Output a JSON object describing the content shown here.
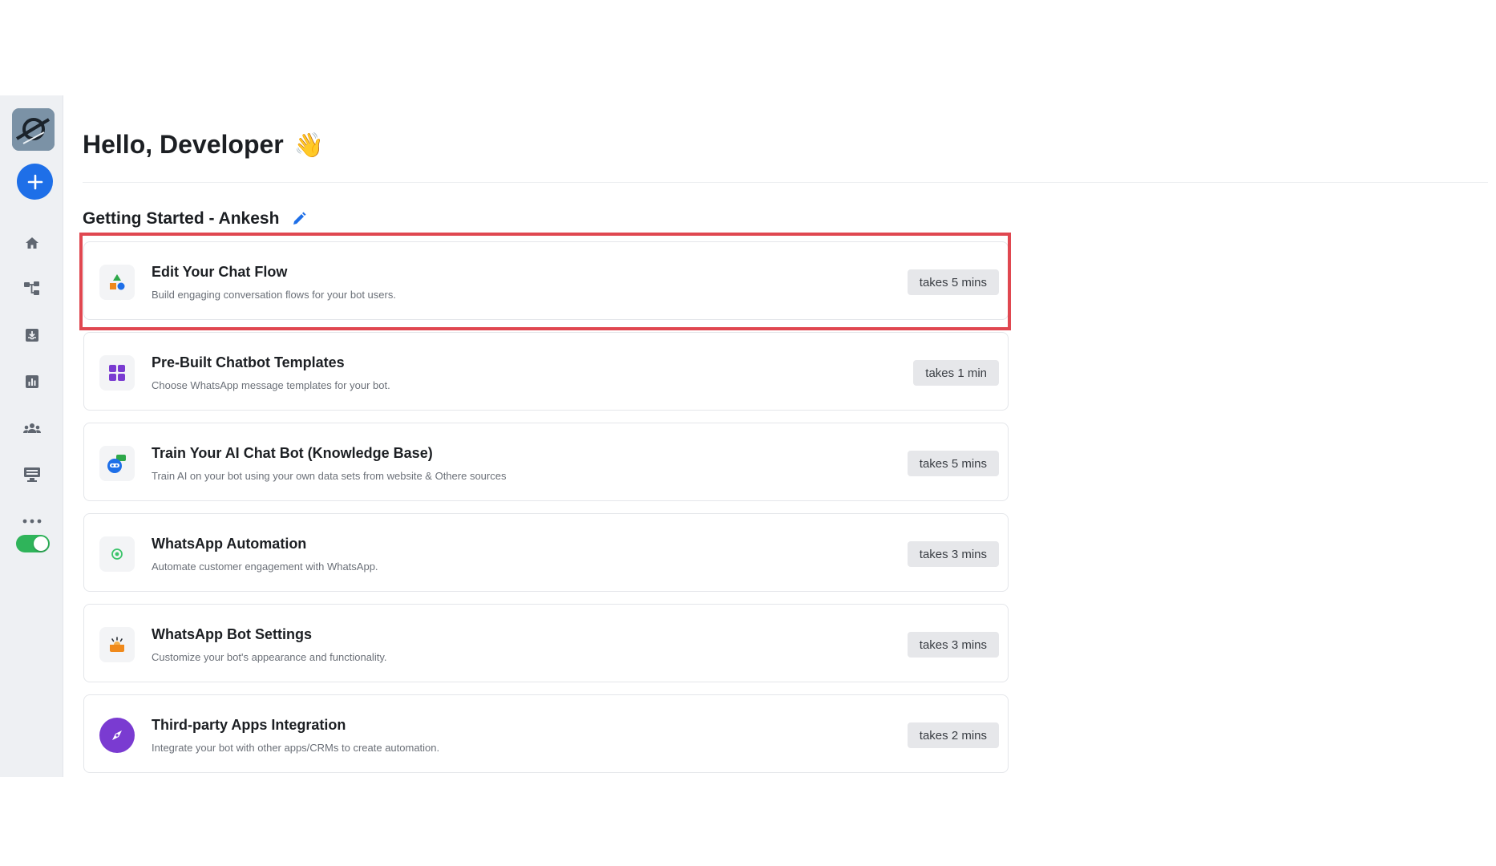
{
  "header": {
    "greeting": "Hello, Developer",
    "greeting_emoji": "👋"
  },
  "section": {
    "title": "Getting Started - Ankesh"
  },
  "cards": [
    {
      "title": "Edit Your Chat Flow",
      "description": "Build engaging conversation flows for your bot users.",
      "duration": "takes 5 mins",
      "icon": "shapes-icon"
    },
    {
      "title": "Pre-Built Chatbot Templates",
      "description": "Choose WhatsApp message templates for your bot.",
      "duration": "takes 1 min",
      "icon": "grid-icon"
    },
    {
      "title": "Train Your AI Chat Bot (Knowledge Base)",
      "description": "Train AI on your bot using your own data sets from website & Othere sources",
      "duration": "takes 5 mins",
      "icon": "ai-bot-icon"
    },
    {
      "title": "WhatsApp Automation",
      "description": "Automate customer engagement with WhatsApp.",
      "duration": "takes 3 mins",
      "icon": "whatsapp-icon"
    },
    {
      "title": "WhatsApp Bot Settings",
      "description": "Customize your bot's appearance and functionality.",
      "duration": "takes 3 mins",
      "icon": "bot-settings-icon"
    },
    {
      "title": "Third-party Apps Integration",
      "description": "Integrate your bot with other apps/CRMs to create automation.",
      "duration": "takes 2 mins",
      "icon": "compass-icon"
    }
  ],
  "sidebar": {
    "items": [
      "home-icon",
      "flow-icon",
      "inbox-icon",
      "analytics-icon",
      "contacts-icon",
      "broadcast-icon",
      "more-icon"
    ],
    "toggle_state": "on"
  },
  "colors": {
    "accent": "#1e6fe8",
    "highlight": "#e04750",
    "toggle": "#2fb45a"
  }
}
